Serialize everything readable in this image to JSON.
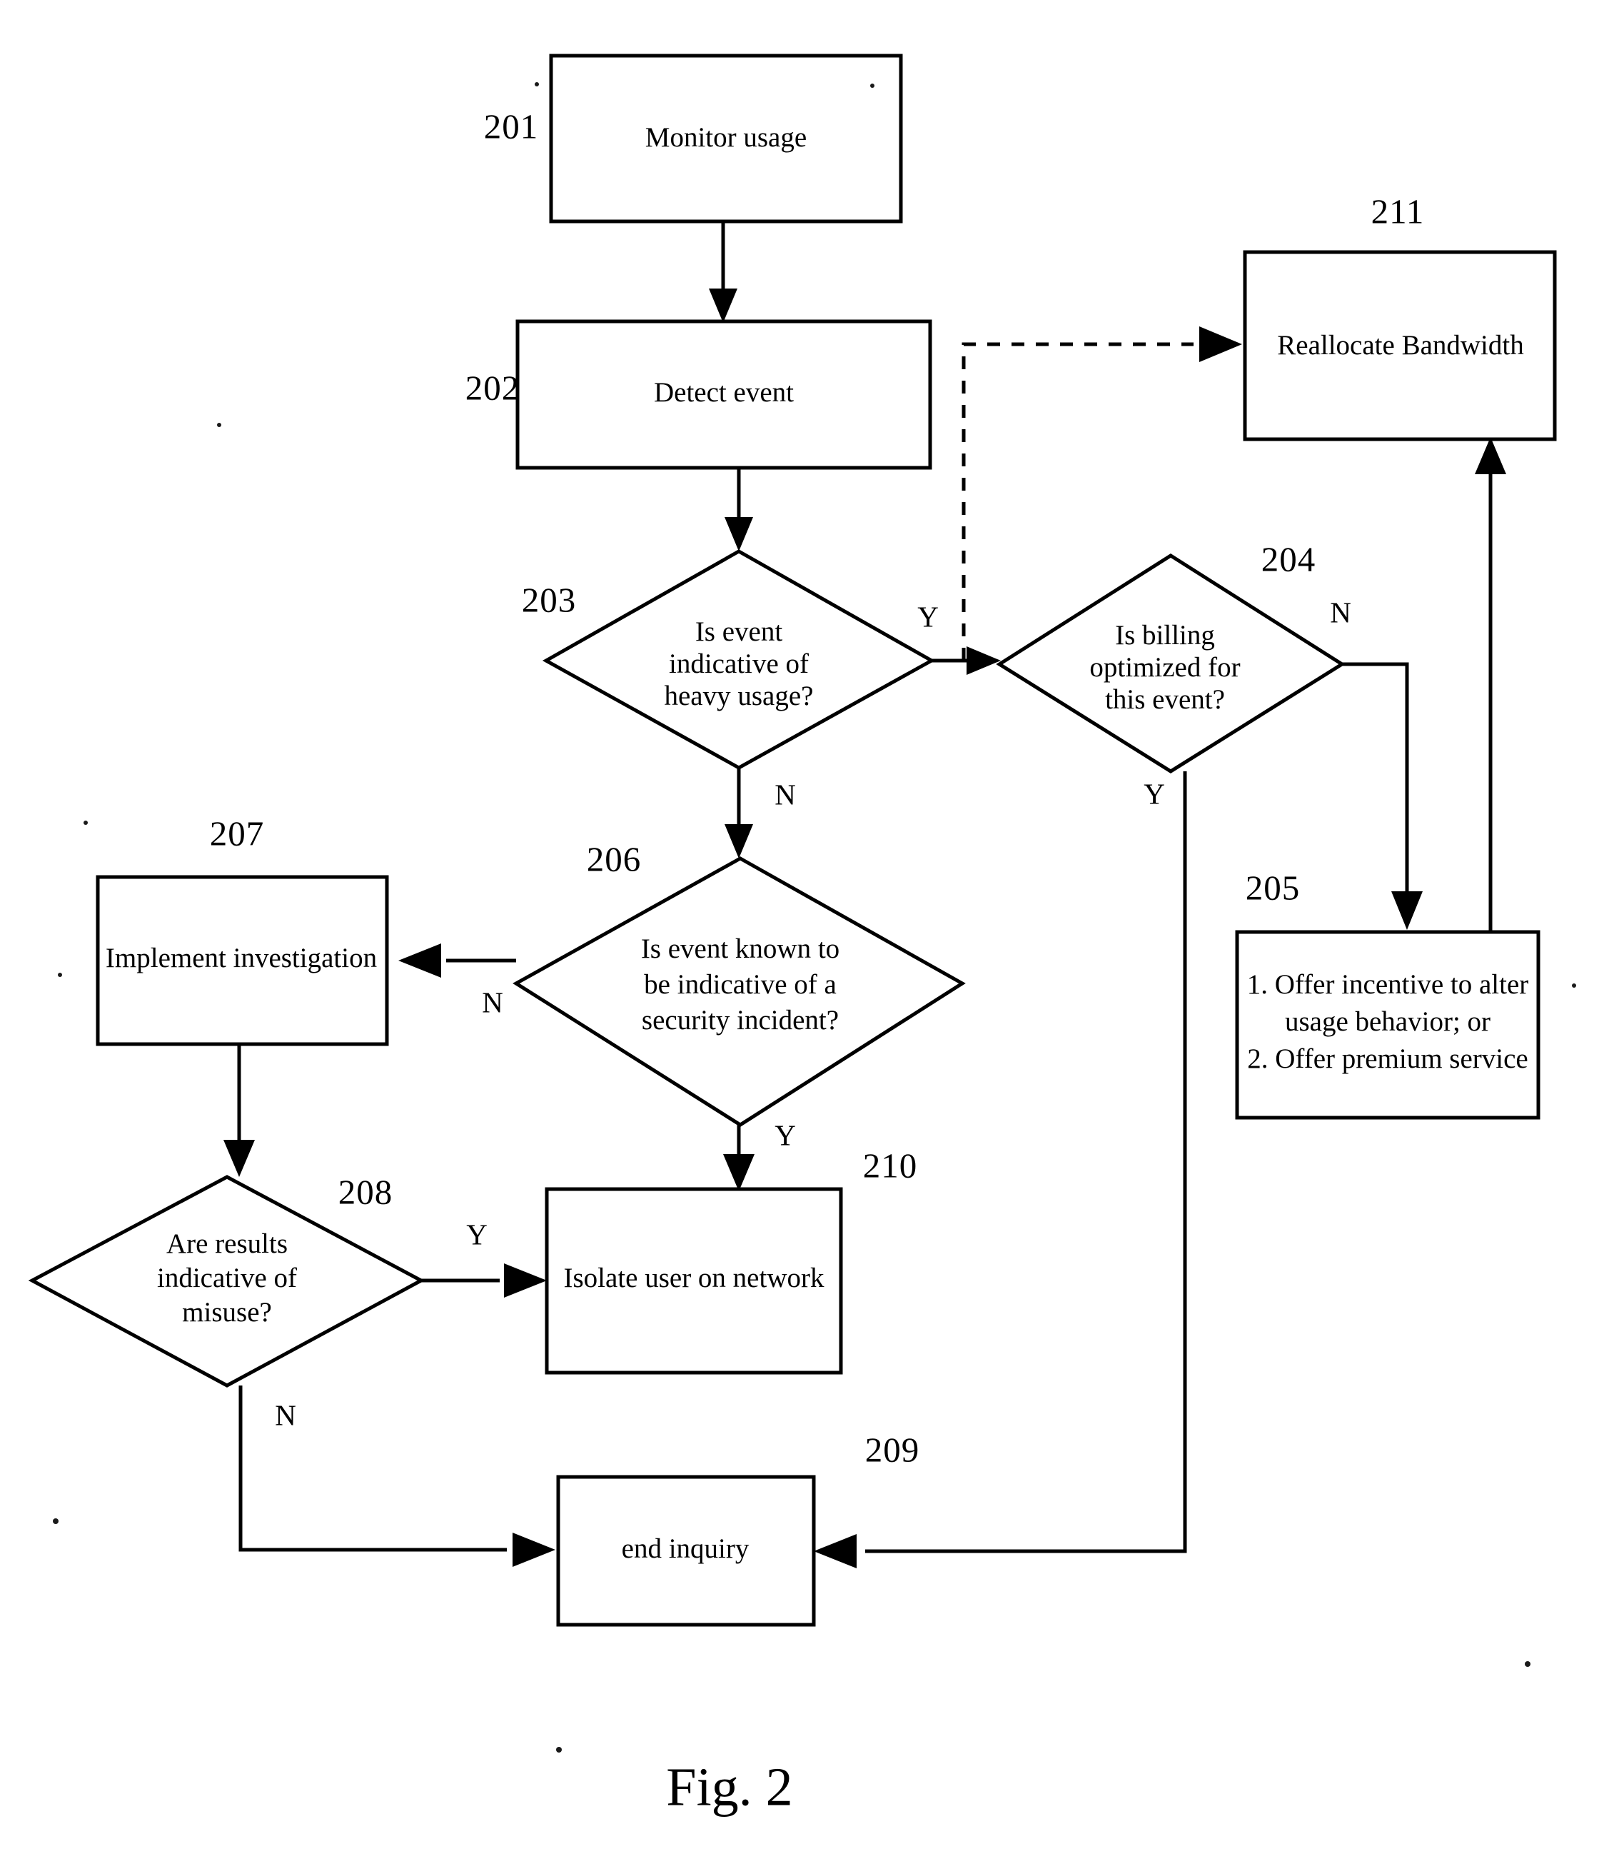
{
  "figure": {
    "caption": "Fig. 2",
    "nodes": {
      "n201": {
        "ref": "201",
        "label": "Monitor usage",
        "shape": "process"
      },
      "n202": {
        "ref": "202",
        "label": "Detect event",
        "shape": "process"
      },
      "n203": {
        "ref": "203",
        "shape": "decision",
        "line1": "Is event",
        "line2": "indicative of",
        "line3": "heavy usage?"
      },
      "n204": {
        "ref": "204",
        "shape": "decision",
        "line1": "Is billing",
        "line2": "optimized for",
        "line3": "this event?"
      },
      "n205": {
        "ref": "205",
        "shape": "process",
        "line1": "1. Offer incentive to alter",
        "line2": "usage behavior; or",
        "line3": "2. Offer premium service"
      },
      "n206": {
        "ref": "206",
        "shape": "decision",
        "line1": "Is event known to",
        "line2": "be indicative of a",
        "line3": "security incident?"
      },
      "n207": {
        "ref": "207",
        "label": "Implement investigation",
        "shape": "process"
      },
      "n208": {
        "ref": "208",
        "shape": "decision",
        "line1": "Are results",
        "line2": "indicative of",
        "line3": "misuse?"
      },
      "n209": {
        "ref": "209",
        "label": "end inquiry",
        "shape": "process"
      },
      "n210": {
        "ref": "210",
        "label": "Isolate user on network",
        "shape": "process"
      },
      "n211": {
        "ref": "211",
        "label": "Reallocate Bandwidth",
        "shape": "process"
      }
    },
    "branch_labels": {
      "b203_yes": "Y",
      "b203_no": "N",
      "b204_no": "N",
      "b204_yes": "Y",
      "b206_no": "N",
      "b206_yes": "Y",
      "b208_yes": "Y",
      "b208_no": "N"
    },
    "colors": {
      "stroke": "#000000",
      "fill": "#ffffff",
      "text": "#000000"
    }
  }
}
